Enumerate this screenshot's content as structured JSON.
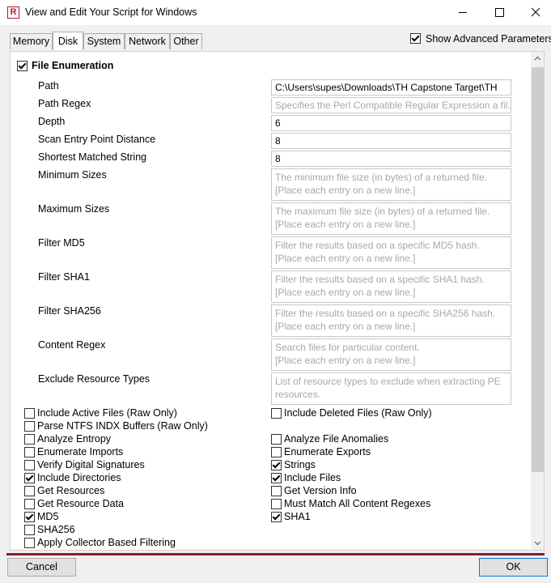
{
  "window": {
    "title": "View and Edit Your Script for Windows",
    "app_icon_letter": "R",
    "controls": [
      "minimize-icon",
      "maximize-icon",
      "close-icon"
    ]
  },
  "tabs": [
    {
      "label": "Memory",
      "active": false
    },
    {
      "label": "Disk",
      "active": true
    },
    {
      "label": "System",
      "active": false
    },
    {
      "label": "Network",
      "active": false
    },
    {
      "label": "Other",
      "active": false
    }
  ],
  "advanced": {
    "label": "Show Advanced Parameters",
    "checked": true
  },
  "file_enumeration": {
    "label": "File Enumeration",
    "checked": true
  },
  "fields": {
    "path": {
      "label": "Path",
      "value": "C:\\Users\\supes\\Downloads\\TH Capstone Target\\TH"
    },
    "path_regex": {
      "label": "Path Regex",
      "placeholder": "Specifies the Perl Compatible Regular Expression a fil..."
    },
    "depth": {
      "label": "Depth",
      "value": "6"
    },
    "scan_entry": {
      "label": "Scan Entry Point Distance",
      "value": "8"
    },
    "shortest": {
      "label": "Shortest Matched String",
      "value": "8"
    },
    "min_sizes": {
      "label": "Minimum Sizes",
      "placeholder_1": "The minimum file size (in bytes) of a returned file.",
      "placeholder_2": "[Place each entry on a new line.]"
    },
    "max_sizes": {
      "label": "Maximum Sizes",
      "placeholder_1": "The maximum file size (in bytes) of a returned file.",
      "placeholder_2": "[Place each entry on a new line.]"
    },
    "filter_md5": {
      "label": "Filter MD5",
      "placeholder_1": "Filter the results based on a specific MD5 hash.",
      "placeholder_2": "[Place each entry on a new line.]"
    },
    "filter_sha1": {
      "label": "Filter SHA1",
      "placeholder_1": "Filter the results based on a specific SHA1 hash.",
      "placeholder_2": "[Place each entry on a new line.]"
    },
    "filter_sha256": {
      "label": "Filter SHA256",
      "placeholder_1": "Filter the results based on a specific SHA256 hash.",
      "placeholder_2": "[Place each entry on a new line.]"
    },
    "content_regex": {
      "label": "Content Regex",
      "placeholder_1": "Search files for particular content.",
      "placeholder_2": "[Place each entry on a new line.]"
    },
    "exclude_types": {
      "label": "Exclude Resource Types",
      "placeholder_1": "List of resource types to exclude when extracting PE",
      "placeholder_2": "resources."
    }
  },
  "options_left": [
    {
      "label": "Include Active Files (Raw Only)",
      "checked": false
    },
    {
      "label": "Parse NTFS INDX Buffers (Raw Only)",
      "checked": false
    },
    {
      "label": "Analyze Entropy",
      "checked": false
    },
    {
      "label": "Enumerate Imports",
      "checked": false
    },
    {
      "label": "Verify Digital Signatures",
      "checked": false
    },
    {
      "label": "Include Directories",
      "checked": true
    },
    {
      "label": "Get Resources",
      "checked": false
    },
    {
      "label": "Get Resource Data",
      "checked": false
    },
    {
      "label": "MD5",
      "checked": true
    },
    {
      "label": "SHA256",
      "checked": false
    },
    {
      "label": "Apply Collector Based Filtering",
      "checked": false
    }
  ],
  "options_right": [
    {
      "label": "Include Deleted Files (Raw Only)",
      "checked": false
    },
    {
      "label": "Analyze File Anomalies",
      "checked": false
    },
    {
      "label": "Enumerate Exports",
      "checked": false
    },
    {
      "label": "Strings",
      "checked": true
    },
    {
      "label": "Include Files",
      "checked": true
    },
    {
      "label": "Get Version Info",
      "checked": false
    },
    {
      "label": "Must Match All Content Regexes",
      "checked": false
    },
    {
      "label": "SHA1",
      "checked": true
    }
  ],
  "buttons": {
    "cancel": "Cancel",
    "ok": "OK"
  },
  "colors": {
    "brand": "#b5162b",
    "rule": "#8b1c2b",
    "ok_border": "#0078d7"
  }
}
